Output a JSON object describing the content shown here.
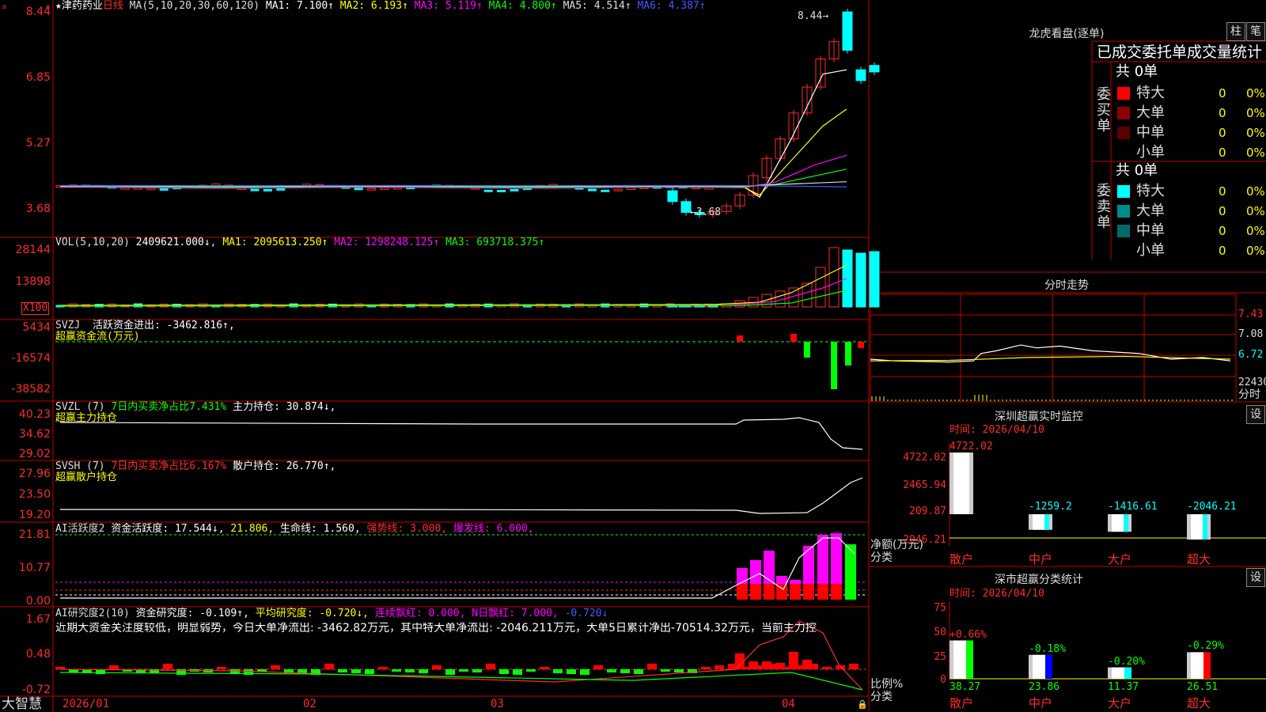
{
  "stock": {
    "name": "★津药药业",
    "period": "日线",
    "ma_params": "MA(5,10,20,30,60,120)",
    "ma_values": [
      {
        "label": "MA1: 7.100↑",
        "color": "#ffffff"
      },
      {
        "label": "MA2: 6.193↑",
        "color": "#ffff00"
      },
      {
        "label": "MA3: 5.119↑",
        "color": "#ff00ff"
      },
      {
        "label": "MA4: 4.800↑",
        "color": "#00ff00"
      },
      {
        "label": "MA5: 4.514↑",
        "color": "#dddddd"
      },
      {
        "label": "MA6: 4.387↑",
        "color": "#3b5bff"
      }
    ],
    "high_mark": "8.44",
    "low_mark": "3.68",
    "y_ticks": [
      "8.44",
      "6.85",
      "5.27",
      "3.68"
    ]
  },
  "vol": {
    "header": "VOL(5,10,20)",
    "value": "2409621.000↓",
    "ma": [
      {
        "label": "MA1: 2095613.250↑",
        "color": "#ffff00"
      },
      {
        "label": "MA2: 1298248.125↑",
        "color": "#ff00ff"
      },
      {
        "label": "MA3: 693718.375↑",
        "color": "#00ff00"
      }
    ],
    "y_ticks": [
      "28144",
      "13898"
    ],
    "unit": "X100"
  },
  "svzj": {
    "header": "SVZJ",
    "text": "活跃资金进出: -3462.816↑,",
    "sub": "超赢资金流(万元)",
    "y_ticks": [
      "5434",
      "-16574",
      "-38582"
    ]
  },
  "svzl": {
    "header": "SVZL (7)",
    "ratio": "7日内买卖净占比7.431%",
    "hold": "主力持仓: 30.874↓,",
    "sub": "超赢主力持仓",
    "y_ticks": [
      "40.23",
      "34.62",
      "29.02"
    ]
  },
  "svsh": {
    "header": "SVSH (7)",
    "ratio": "7日内买卖净占比6.167%",
    "hold": "散户持仓: 26.770↑,",
    "sub": "超赢散户持仓",
    "y_ticks": [
      "27.96",
      "23.50",
      "19.20"
    ]
  },
  "ai1": {
    "header": "AI活跃度2",
    "active": "资金活跃度: 17.544↓,",
    "v2": "21.806,",
    "life": "生命线: 1.560,",
    "strong": "强势线: 3.000,",
    "burst": "爆发线: 6.000,",
    "y_ticks": [
      "21.81",
      "10.77",
      "0.00"
    ]
  },
  "ai2": {
    "header": "AI研究度2(10)",
    "research": "资金研究度: -0.109↑,",
    "avg": "平均研究度: -0.720↓,",
    "cont": "连续飘红: 0.000,",
    "nday": "N日飘红: 7.000,",
    "neg": "-0.720↓",
    "comment": "近期大资金关注度较低，明显弱势，今日大单净流出: -3462.82万元，其中特大单净流出: -2046.211万元，大单5日累计净出-70514.32万元，当前主力控",
    "y_ticks": [
      "1.67",
      "0.48",
      "-0.72"
    ]
  },
  "xaxis": {
    "labels": [
      "2026/01",
      "02",
      "03",
      "04"
    ],
    "brand": "大智慧"
  },
  "lhb": {
    "title": "龙虎看盘(逐单)",
    "btn1": "柱",
    "btn2": "笔",
    "tabs": "已成交委托单成交量统计",
    "buy_label": "委买单",
    "sell_label": "委卖单",
    "buy_total": "共 0单",
    "sell_total": "共 0单",
    "buy_rows": [
      {
        "name": "特大",
        "n": "0",
        "p": "0%",
        "color": "#ff0000"
      },
      {
        "name": "大单",
        "n": "0",
        "p": "0%",
        "color": "#8b0000"
      },
      {
        "name": "中单",
        "n": "0",
        "p": "0%",
        "color": "#5a0000"
      },
      {
        "name": "小单",
        "n": "0",
        "p": "0%",
        "color": "#000000"
      }
    ],
    "sell_rows": [
      {
        "name": "特大",
        "n": "0",
        "p": "0%",
        "color": "#00ffff"
      },
      {
        "name": "大单",
        "n": "0",
        "p": "0%",
        "color": "#008b8b"
      },
      {
        "name": "中单",
        "n": "0",
        "p": "0%",
        "color": "#006a6a"
      },
      {
        "name": "小单",
        "n": "0",
        "p": "0%",
        "color": "#000000"
      }
    ]
  },
  "fenshi": {
    "title": "分时走势",
    "y_ticks": [
      "7.43",
      "7.08",
      "6.72"
    ],
    "vol_tick": "22430",
    "unit": "分时"
  },
  "monitor": {
    "title": "深圳超赢实时监控",
    "btn": "设",
    "time": "时间: 2026/04/10",
    "y_ticks": [
      "4722.02",
      "2465.94",
      "209.87",
      "-2046.21"
    ],
    "unit1": "净额(万元)",
    "unit2": "分类",
    "bars": [
      {
        "cat": "散户",
        "value": "4722.02"
      },
      {
        "cat": "中户",
        "value": "-1259.2"
      },
      {
        "cat": "大户",
        "value": "-1416.61"
      },
      {
        "cat": "超大",
        "value": "-2046.21"
      }
    ]
  },
  "classify": {
    "title": "深市超赢分类统计",
    "btn": "设",
    "time": "时间: 2026/04/10",
    "y_ticks": [
      "75",
      "50",
      "25",
      "0"
    ],
    "unit1": "比例%",
    "unit2": "分类",
    "bars": [
      {
        "cat": "散户",
        "top": "+0.66%",
        "bottom": "38.27"
      },
      {
        "cat": "中户",
        "top": "-0.18%",
        "bottom": "23.86"
      },
      {
        "cat": "大户",
        "top": "-0.20%",
        "bottom": "11.37"
      },
      {
        "cat": "超大",
        "top": "-0.29%",
        "bottom": "26.51"
      }
    ]
  }
}
